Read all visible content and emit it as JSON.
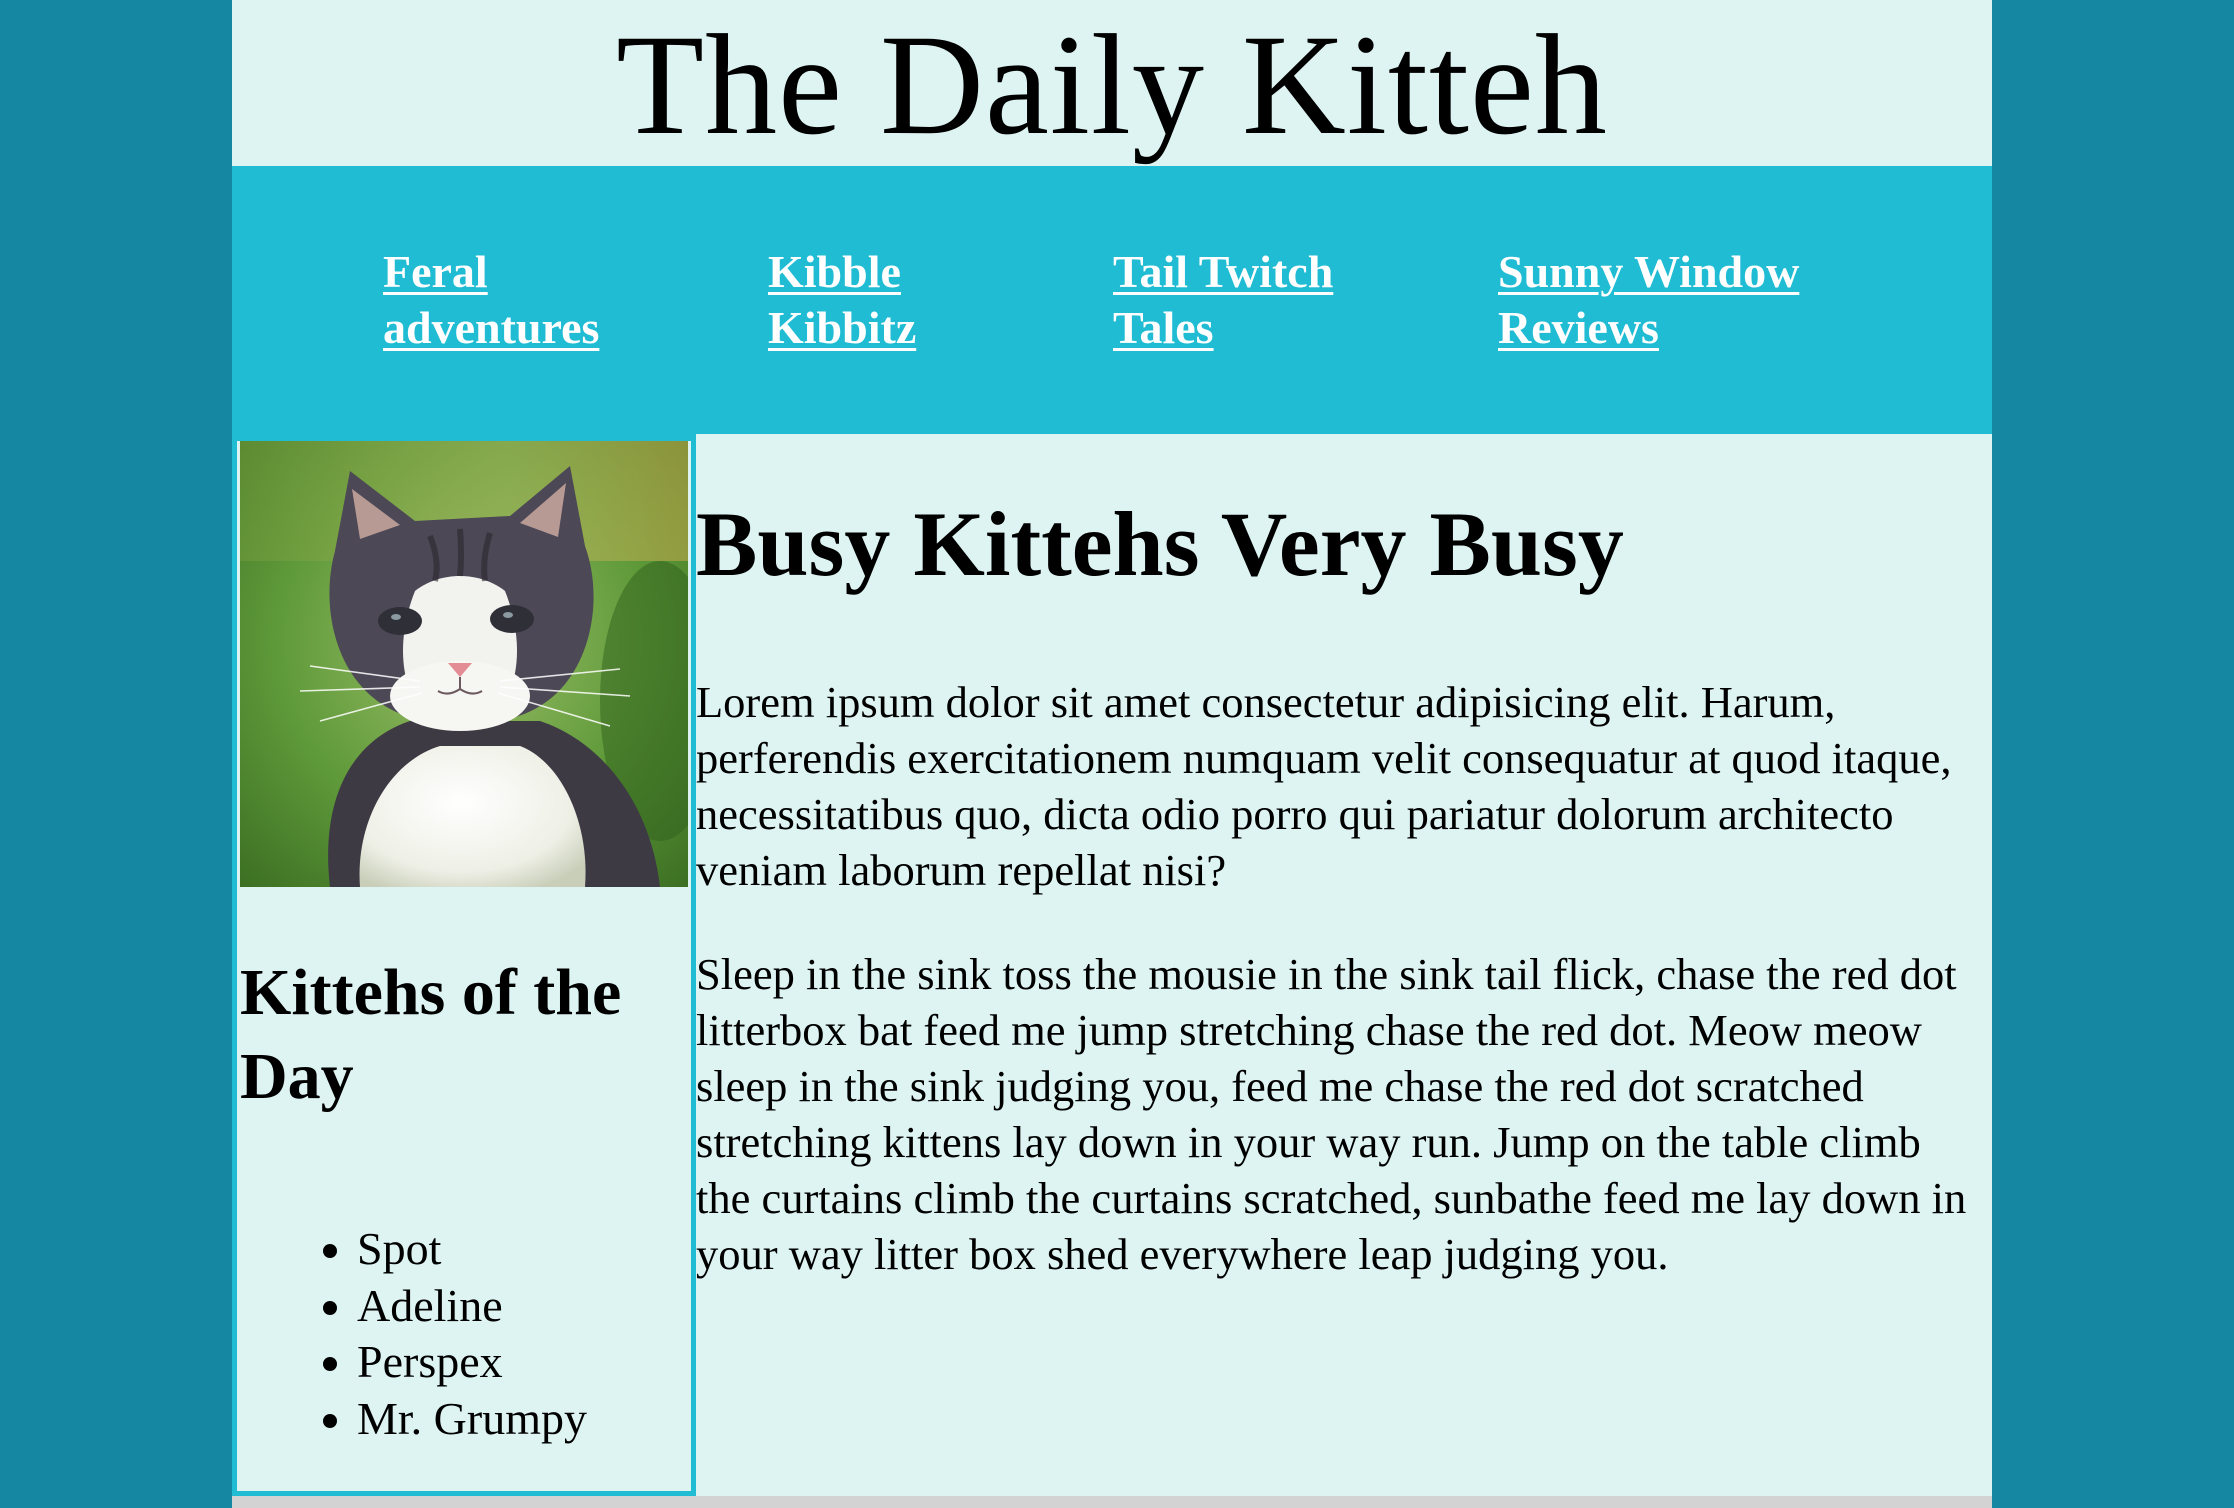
{
  "site": {
    "title": "The Daily Kitteh"
  },
  "nav": {
    "links": [
      {
        "label": "Feral adventures"
      },
      {
        "label": "Kibble Kibbitz"
      },
      {
        "label": "Tail Twitch Tales"
      },
      {
        "label": "Sunny Window Reviews"
      }
    ]
  },
  "sidebar": {
    "heading": "Kittehs of the Day",
    "kittehs": [
      "Spot",
      "Adeline",
      "Perspex",
      "Mr. Grumpy"
    ]
  },
  "article": {
    "heading": "Busy Kittehs Very Busy",
    "paragraphs": [
      "Lorem ipsum dolor sit amet consectetur adipisicing elit. Harum, perferendis exercitationem numquam velit consequatur at quod itaque, necessitatibus quo, dicta odio porro qui pariatur dolorum architecto veniam laborum repellat nisi?",
      "Sleep in the sink toss the mousie in the sink tail flick, chase the red dot litterbox bat feed me jump stretching chase the red dot. Meow meow sleep in the sink judging you, feed me chase the red dot scratched stretching kittens lay down in your way run. Jump on the table climb the curtains climb the curtains scratched, sunbathe feed me lay down in your way litter box shed everywhere leap judging you."
    ]
  },
  "colors": {
    "outer_background": "#1587a3",
    "page_background": "#ddf4f3",
    "nav_background": "#1fbcd3",
    "nav_link": "#ffffff"
  }
}
